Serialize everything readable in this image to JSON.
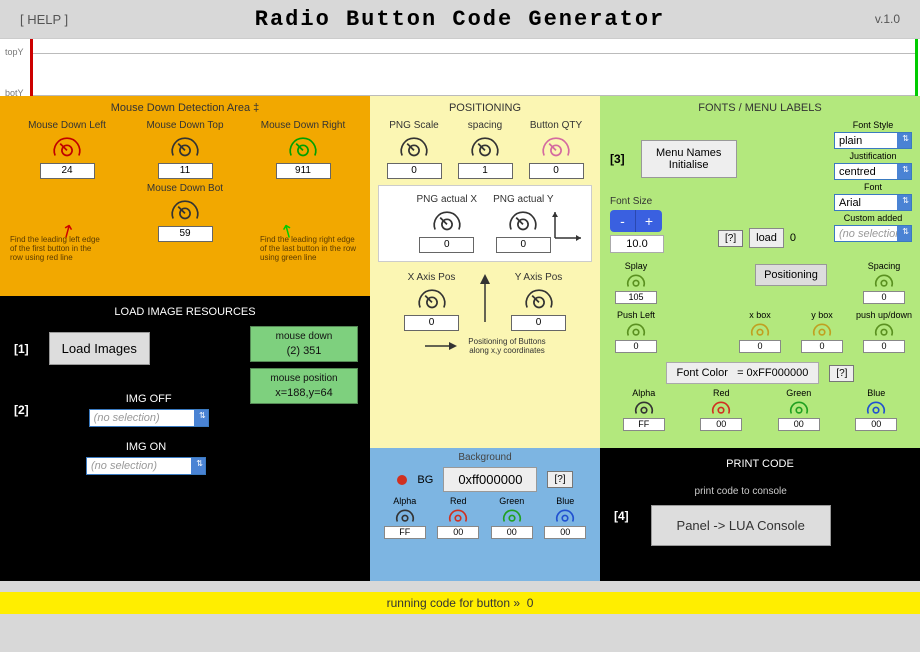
{
  "header": {
    "help": "[ HELP ]",
    "title": "Radio Button Code Generator",
    "version": "v.1.0"
  },
  "strip": {
    "topLabel": "topY",
    "botLabel": "botY"
  },
  "orange": {
    "title": "Mouse Down Detection Area ‡",
    "dials": {
      "left": {
        "label": "Mouse Down Left",
        "value": "24",
        "color": "#c00000"
      },
      "top": {
        "label": "Mouse Down Top",
        "value": "11",
        "color": "#333"
      },
      "right": {
        "label": "Mouse Down Right",
        "value": "911",
        "color": "#00a000"
      },
      "bot": {
        "label": "Mouse Down Bot",
        "value": "59",
        "color": "#333"
      }
    },
    "hintLeft": "Find the leading left edge of the first button in the row using red line",
    "hintRight": "Find the leading right edge of the last button in the row using green line"
  },
  "resources": {
    "title": "LOAD IMAGE RESOURCES",
    "step1": "[1]",
    "loadBtn": "Load Images",
    "mouseDown": {
      "label": "mouse down",
      "value": "(2) 351"
    },
    "mousePos": {
      "label": "mouse position",
      "value": "x=188,y=64"
    },
    "step2": "[2]",
    "imgOff": {
      "label": "IMG OFF",
      "placeholder": "(no selection)"
    },
    "imgOn": {
      "label": "IMG ON",
      "placeholder": "(no selection)"
    }
  },
  "positioning": {
    "title": "POSITIONING",
    "row1": {
      "scale": {
        "label": "PNG Scale",
        "value": "0"
      },
      "spacing": {
        "label": "spacing",
        "value": "1"
      },
      "qty": {
        "label": "Button QTY",
        "value": "0",
        "color": "#d46aa0"
      }
    },
    "row2": {
      "actualX": {
        "label": "PNG actual X",
        "value": "0"
      },
      "actualY": {
        "label": "PNG actual Y",
        "value": "0"
      }
    },
    "row3": {
      "xpos": {
        "label": "X Axis Pos",
        "value": "0"
      },
      "ypos": {
        "label": "Y Axis Pos",
        "value": "0"
      }
    },
    "posHint": "Positioning of Buttons along x,y coordinates"
  },
  "background": {
    "title": "Background",
    "bgLabel": "BG",
    "hex": "0xff000000",
    "q": "[?]",
    "channels": {
      "alpha": {
        "label": "Alpha",
        "value": "FF",
        "color": "#333"
      },
      "red": {
        "label": "Red",
        "value": "00",
        "color": "#d03020"
      },
      "green": {
        "label": "Green",
        "value": "00",
        "color": "#20a020"
      },
      "blue": {
        "label": "Blue",
        "value": "00",
        "color": "#2050d0"
      }
    }
  },
  "fonts": {
    "title": "FONTS / MENU LABELS",
    "step3": "[3]",
    "menuBtn": "Menu Names Initialise",
    "styleLabel": "Font Style",
    "style": "plain",
    "justLabel": "Justification",
    "just": "centred",
    "fontLabel": "Font",
    "font": "Arial",
    "customLabel": "Custom added",
    "custom": "(no selection)",
    "fontSizeLabel": "Font Size",
    "fontSize": "10.0",
    "q": "[?]",
    "loadBtn": "load",
    "loadIdx": "0",
    "splay": {
      "label": "Splay",
      "value": "105"
    },
    "spacing": {
      "label": "Spacing",
      "value": "0"
    },
    "positioningBtn": "Positioning",
    "pushLeft": {
      "label": "Push Left",
      "value": "0"
    },
    "xbox": {
      "label": "x box",
      "value": "0"
    },
    "ybox": {
      "label": "y box",
      "value": "0"
    },
    "pushUpDown": {
      "label": "push up/down",
      "value": "0"
    },
    "fontColorLabel": "Font Color",
    "fontColorEq": "= 0xFF000000",
    "channels": {
      "alpha": {
        "label": "Alpha",
        "value": "FF",
        "color": "#333"
      },
      "red": {
        "label": "Red",
        "value": "00",
        "color": "#d03020"
      },
      "green": {
        "label": "Green",
        "value": "00",
        "color": "#20a020"
      },
      "blue": {
        "label": "Blue",
        "value": "00",
        "color": "#2050d0"
      }
    }
  },
  "print": {
    "title": "PRINT CODE",
    "step4": "[4]",
    "label": "print code to console",
    "btn": "Panel -> LUA Console"
  },
  "status": {
    "text": "running code for button »",
    "idx": "0"
  }
}
